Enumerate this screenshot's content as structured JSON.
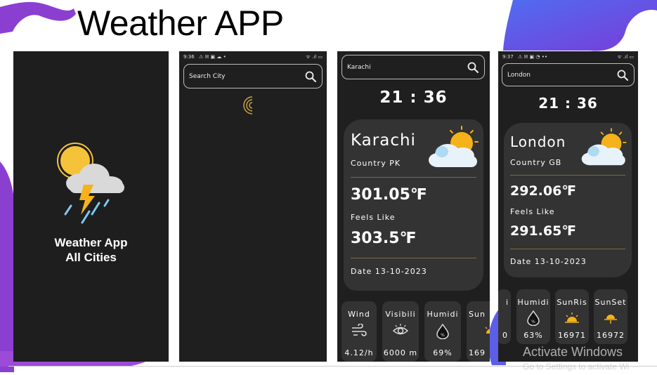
{
  "slide_title": "Weather APP",
  "colors": {
    "accent_purple": "#9b4bd8",
    "accent_blue": "#4a5fe0",
    "screen_bg": "#1f1f1f",
    "card_bg": "#333333",
    "sun": "#f5c23a"
  },
  "splash": {
    "line1": "Weather App",
    "line2": "All Cities",
    "icon": "sun-cloud-lightning-icon"
  },
  "search_screen": {
    "status_time": "9:36",
    "status_right": "•  ᯤ .ıl 𝟖𝟖",
    "placeholder": "Search City",
    "loader_icon": "loading-spinner-icon"
  },
  "karachi": {
    "search_value": "Karachi",
    "time": "21 : 36",
    "city": "Karachi",
    "country": "Country PK",
    "temp": "301.05℉",
    "feels_label": "Feels Like",
    "feels_temp": "303.5℉",
    "date": "Date 13-10-2023",
    "tiles": [
      {
        "label": "Wind",
        "icon": "wind-icon",
        "value": "4.12/h"
      },
      {
        "label": "Visibili",
        "icon": "eye-icon",
        "value": "6000 m"
      },
      {
        "label": "Humidi",
        "icon": "drop-icon",
        "value": "69%"
      },
      {
        "label": "Sun",
        "icon": "sunrise-icon",
        "value": "169"
      }
    ]
  },
  "london": {
    "status_time": "9:37",
    "search_value": "London",
    "time": "21 : 36",
    "city": "London",
    "country": "Country GB",
    "temp": "292.06℉",
    "feels_label": "Feels Like",
    "feels_temp": "291.65℉",
    "date": "Date 13-10-2023",
    "tiles": [
      {
        "label": "i",
        "icon": "",
        "value": "0"
      },
      {
        "label": "Humidi",
        "icon": "drop-icon",
        "value": "63%"
      },
      {
        "label": "SunRis",
        "icon": "sunrise-icon",
        "value": "16971"
      },
      {
        "label": "SunSet",
        "icon": "sunset-icon",
        "value": "16972"
      }
    ]
  },
  "watermark": {
    "line1": "Activate Windows",
    "line2": "Go to Settings to activate Wi"
  }
}
